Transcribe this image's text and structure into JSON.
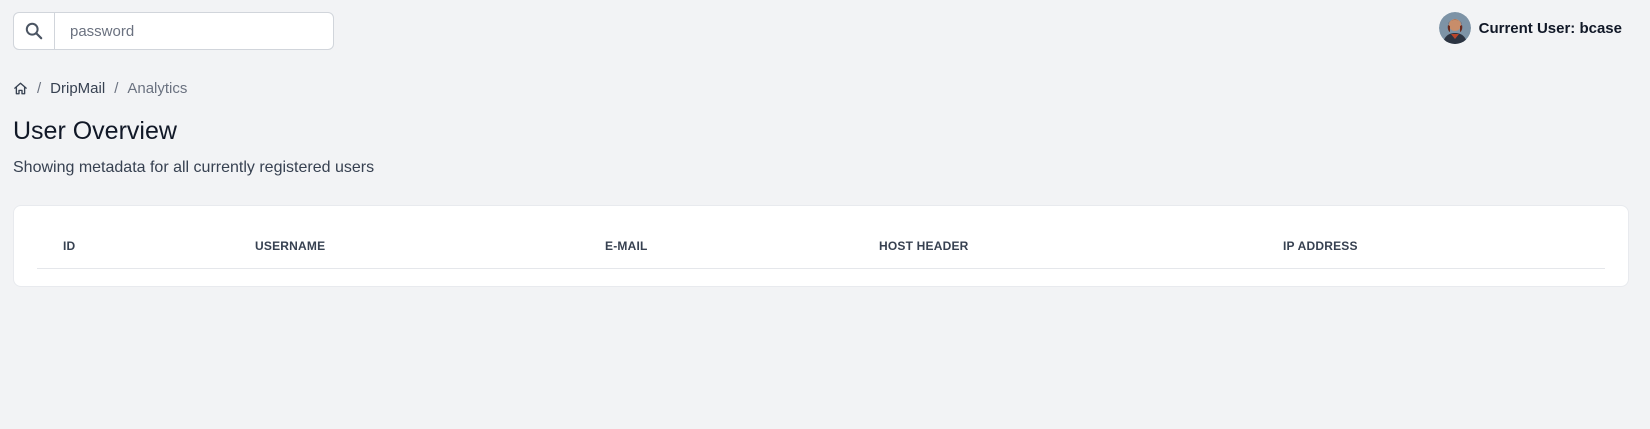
{
  "search": {
    "placeholder": "password",
    "value": "",
    "icon": "search-icon"
  },
  "user": {
    "label": "Current User: bcase",
    "avatar": "avatar"
  },
  "breadcrumb": {
    "home_icon": "home-icon",
    "separator": "/",
    "items": [
      "DripMail",
      "Analytics"
    ]
  },
  "page": {
    "title": "User Overview",
    "subtitle": "Showing metadata for all currently registered users"
  },
  "table": {
    "columns": [
      "ID",
      "USERNAME",
      "E-MAIL",
      "HOST HEADER",
      "IP ADDRESS"
    ],
    "rows": []
  },
  "colors": {
    "background": "#f2f3f5",
    "card": "#ffffff",
    "border": "#d1d5db",
    "text": "#111827",
    "muted": "#6b7280"
  }
}
